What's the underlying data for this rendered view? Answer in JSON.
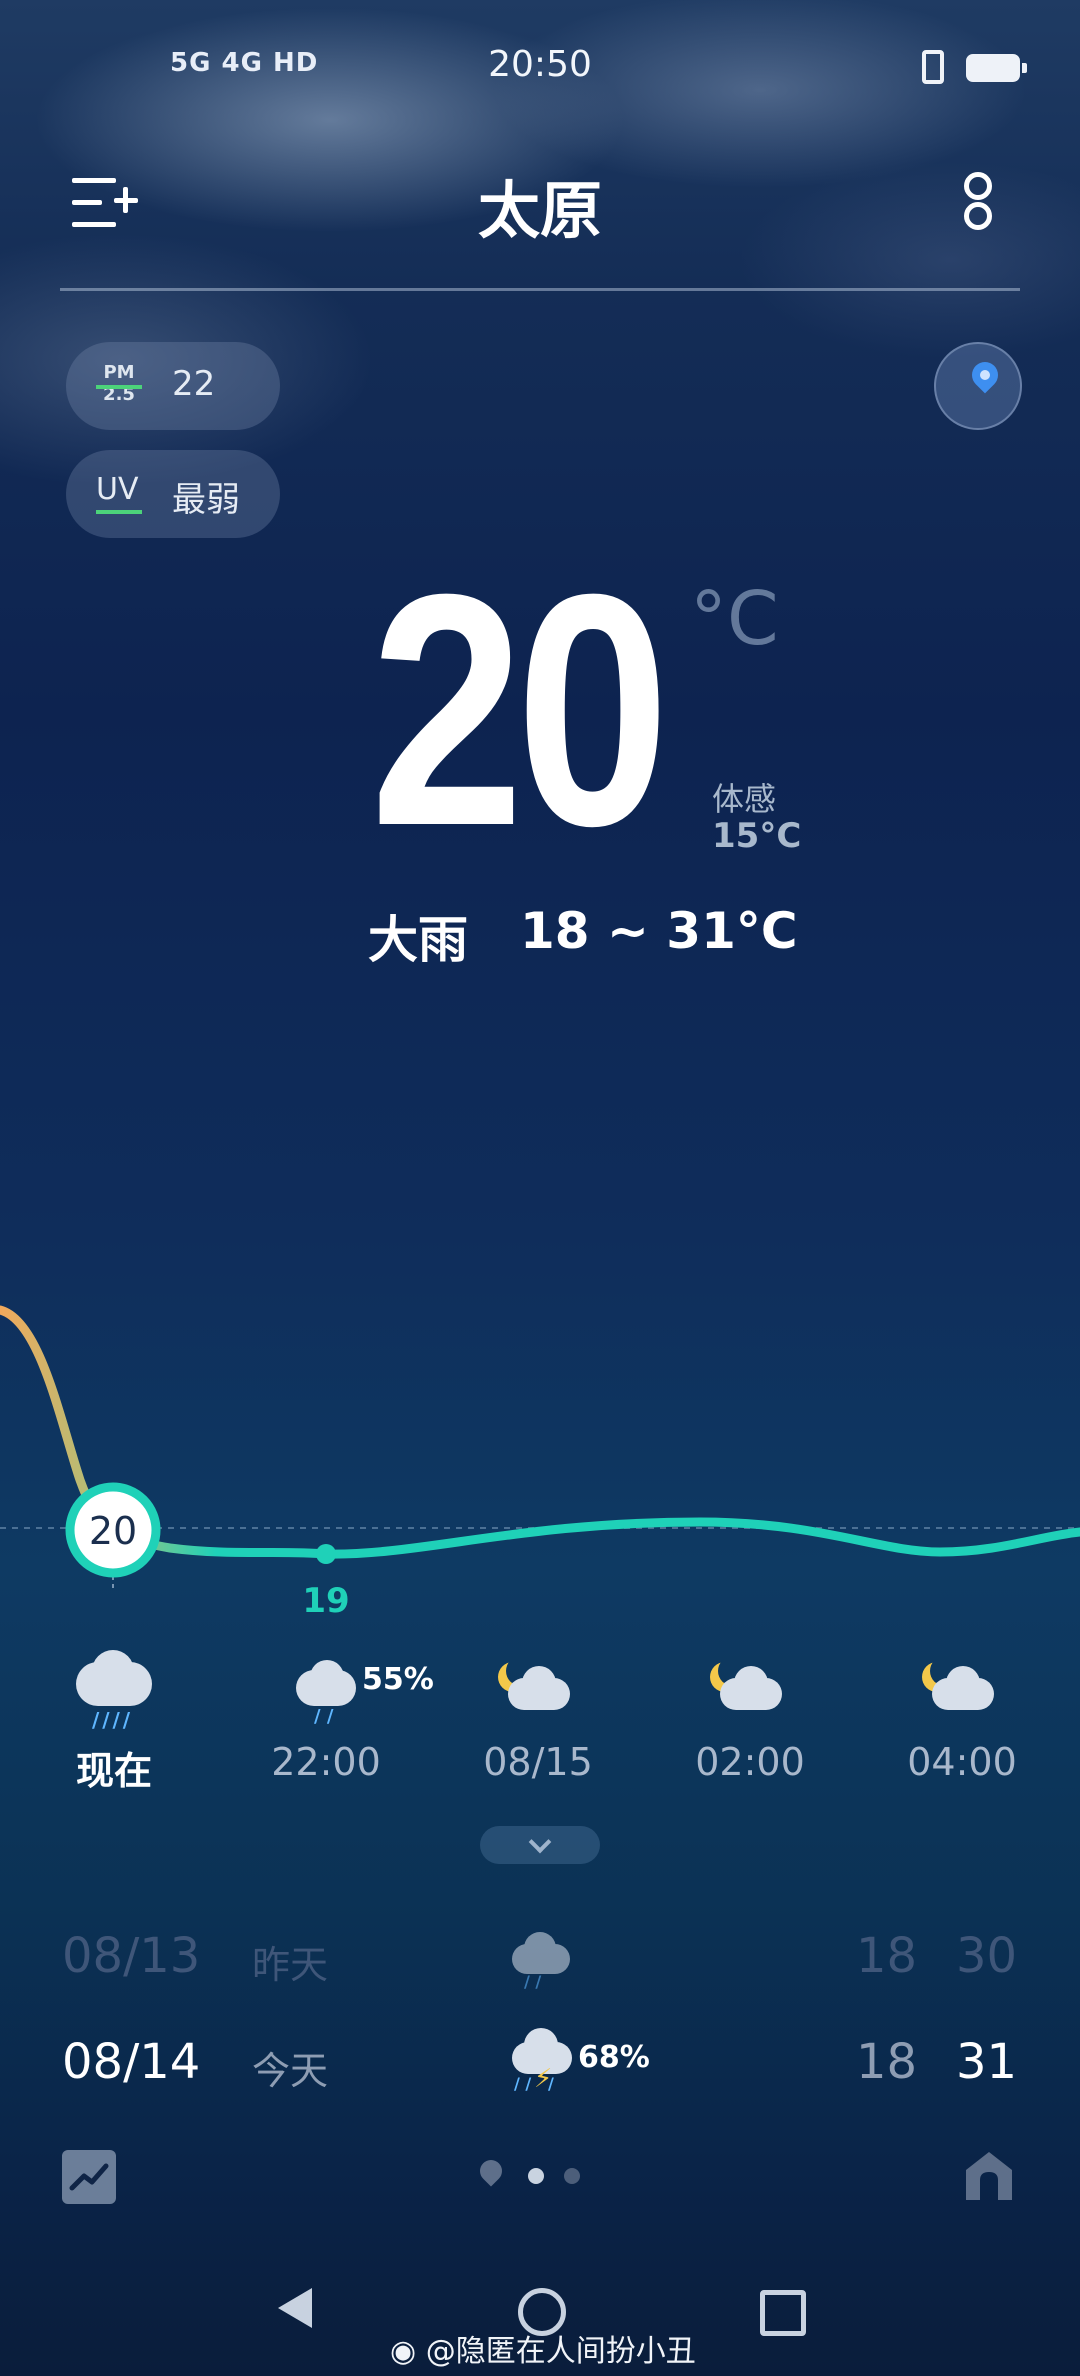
{
  "status_bar": {
    "signals": "5G  4G  HD  ",
    "time": "20:50"
  },
  "header": {
    "city": "太原"
  },
  "air": {
    "pm_label_top": "PM",
    "pm_label_bottom": "2.5",
    "pm_value": "22",
    "uv_label": "UV",
    "uv_value": "最弱"
  },
  "current": {
    "temperature": "20",
    "unit": "°C",
    "feels_like_label": "体感",
    "feels_like_value": "15°C",
    "condition": "大雨",
    "range": "18 ~ 31°C"
  },
  "chart_data": {
    "type": "line",
    "x": [
      "现在",
      "22:00",
      "08/15",
      "02:00",
      "04:00"
    ],
    "series": [
      {
        "values": [
          20,
          19,
          20,
          20,
          20
        ]
      }
    ],
    "point_labels": [
      {
        "x": "现在",
        "value": "20"
      },
      {
        "x": "22:00",
        "value": "19"
      }
    ]
  },
  "hourly": [
    {
      "label": "现在",
      "icon": "heavy-rain-icon",
      "precip": ""
    },
    {
      "label": "22:00",
      "icon": "light-rain-icon",
      "precip": "55%"
    },
    {
      "label": "08/15",
      "icon": "partly-cloudy-night-icon",
      "precip": ""
    },
    {
      "label": "02:00",
      "icon": "partly-cloudy-night-icon",
      "precip": ""
    },
    {
      "label": "04:00",
      "icon": "partly-cloudy-night-icon",
      "precip": ""
    }
  ],
  "daily": [
    {
      "date": "08/13",
      "day": "昨天",
      "icon": "rain-icon",
      "precip": "",
      "low": "18",
      "high": "30"
    },
    {
      "date": "08/14",
      "day": "今天",
      "icon": "thunderstorm-icon",
      "precip": "68%",
      "low": "18",
      "high": "31"
    }
  ],
  "colors": {
    "line": "#1fd1b8",
    "line_warm": "#f2a95c",
    "accent_green": "#4cd37a"
  },
  "watermark": "@隐匿在人间扮小丑"
}
